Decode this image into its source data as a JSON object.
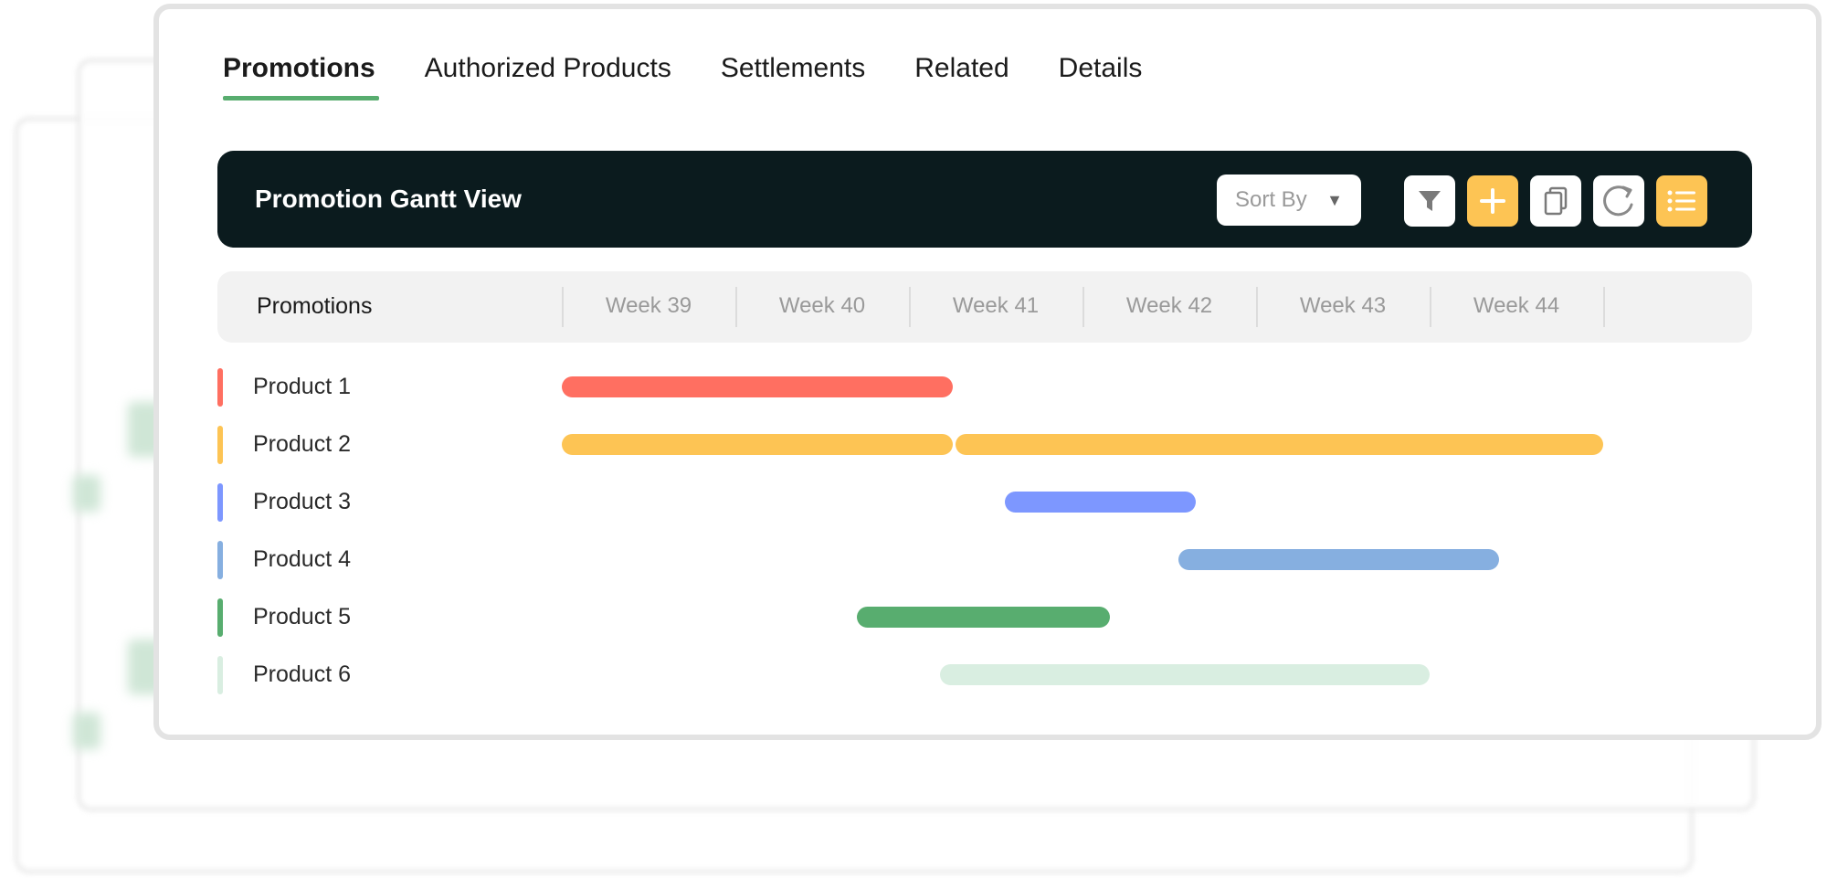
{
  "tabs": [
    {
      "label": "Promotions",
      "active": true
    },
    {
      "label": "Authorized Products",
      "active": false
    },
    {
      "label": "Settlements",
      "active": false
    },
    {
      "label": "Related",
      "active": false
    },
    {
      "label": "Details",
      "active": false
    }
  ],
  "toolbar": {
    "title": "Promotion Gantt View",
    "sort_label": "Sort By",
    "sort_caret": "▼",
    "buttons": [
      {
        "name": "filter-button",
        "icon": "filter-icon"
      },
      {
        "name": "add-button",
        "icon": "plus-icon"
      },
      {
        "name": "copy-button",
        "icon": "copy-icon"
      },
      {
        "name": "refresh-button",
        "icon": "refresh-icon"
      },
      {
        "name": "list-view-button",
        "icon": "list-icon"
      }
    ]
  },
  "gantt": {
    "column_title": "Promotions",
    "weeks": [
      "Week 39",
      "Week 40",
      "Week 41",
      "Week 42",
      "Week 43",
      "Week 44"
    ],
    "rows": [
      {
        "label": "Product 1",
        "color": "#ff6f61",
        "bars": [
          {
            "start": 0.0,
            "end": 2.25
          }
        ]
      },
      {
        "label": "Product 2",
        "color": "#fdc454",
        "bars": [
          {
            "start": 0.0,
            "end": 2.25
          },
          {
            "start": 2.27,
            "end": 6.0
          }
        ]
      },
      {
        "label": "Product 3",
        "color": "#7d97ff",
        "bars": [
          {
            "start": 2.55,
            "end": 3.65
          }
        ]
      },
      {
        "label": "Product 4",
        "color": "#86afe0",
        "bars": [
          {
            "start": 3.55,
            "end": 5.4
          }
        ]
      },
      {
        "label": "Product 5",
        "color": "#58ad6f",
        "bars": [
          {
            "start": 1.7,
            "end": 3.16
          }
        ]
      },
      {
        "label": "Product 6",
        "color": "#d9eee1",
        "bars": [
          {
            "start": 2.18,
            "end": 5.0
          }
        ]
      }
    ]
  },
  "colors": {
    "accent_green": "#58ad6f",
    "toolbar_bg": "#0b1b1e",
    "yellow": "#fdc454"
  }
}
